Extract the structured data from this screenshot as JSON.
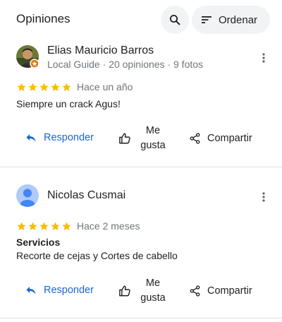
{
  "header": {
    "title": "Opiniones",
    "search_icon": "search-icon",
    "sort_icon": "sort-icon",
    "sort_label": "Ordenar"
  },
  "reviews": [
    {
      "avatar": "photo-avatar",
      "name": "Elias Mauricio Barros",
      "meta": "Local Guide · 20 opiniones · 9 fotos",
      "rating": 5,
      "date": "Hace un año",
      "service_title": "",
      "text": "Siempre un crack Agus!",
      "actions": {
        "reply_label": "Responder",
        "like_line1": "Me",
        "like_line2": "gusta",
        "share_label": "Compartir"
      }
    },
    {
      "avatar": "default-person-avatar",
      "name": "Nicolas Cusmai",
      "meta": "",
      "rating": 5,
      "date": "Hace 2 meses",
      "service_title": "Servicios",
      "text": "Recorte de cejas y Cortes de cabello",
      "actions": {
        "reply_label": "Responder",
        "like_line1": "Me",
        "like_line2": "gusta",
        "share_label": "Compartir"
      }
    }
  ],
  "colors": {
    "star": "#fbbc04",
    "accent": "#1967d2",
    "secondary_text": "#70757a",
    "button_bg": "#f1f3f4",
    "local_guide_badge": "#e8710a"
  }
}
